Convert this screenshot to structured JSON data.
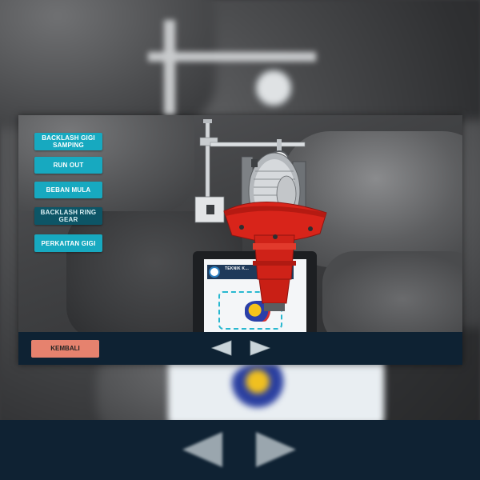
{
  "menu": {
    "items": [
      {
        "label": "BACKLASH GIGI SAMPING",
        "active": false
      },
      {
        "label": "RUN OUT",
        "active": false
      },
      {
        "label": "BEBAN MULA",
        "active": false
      },
      {
        "label": "BACKLASH RING GEAR",
        "active": true
      },
      {
        "label": "PERKAITAN GIGI",
        "active": false
      }
    ]
  },
  "bottom_bar": {
    "back_label": "KEMBALI",
    "prev_icon": "triangle-left-icon",
    "next_icon": "triangle-right-icon"
  },
  "marker_card": {
    "header_text": "TEKNIK K..."
  },
  "colors": {
    "menu_button": "#17a9c0",
    "menu_button_active": "#0d5566",
    "back_button": "#e6826e",
    "bottom_bar": "#0e2233",
    "model_red": "#d8241a"
  }
}
